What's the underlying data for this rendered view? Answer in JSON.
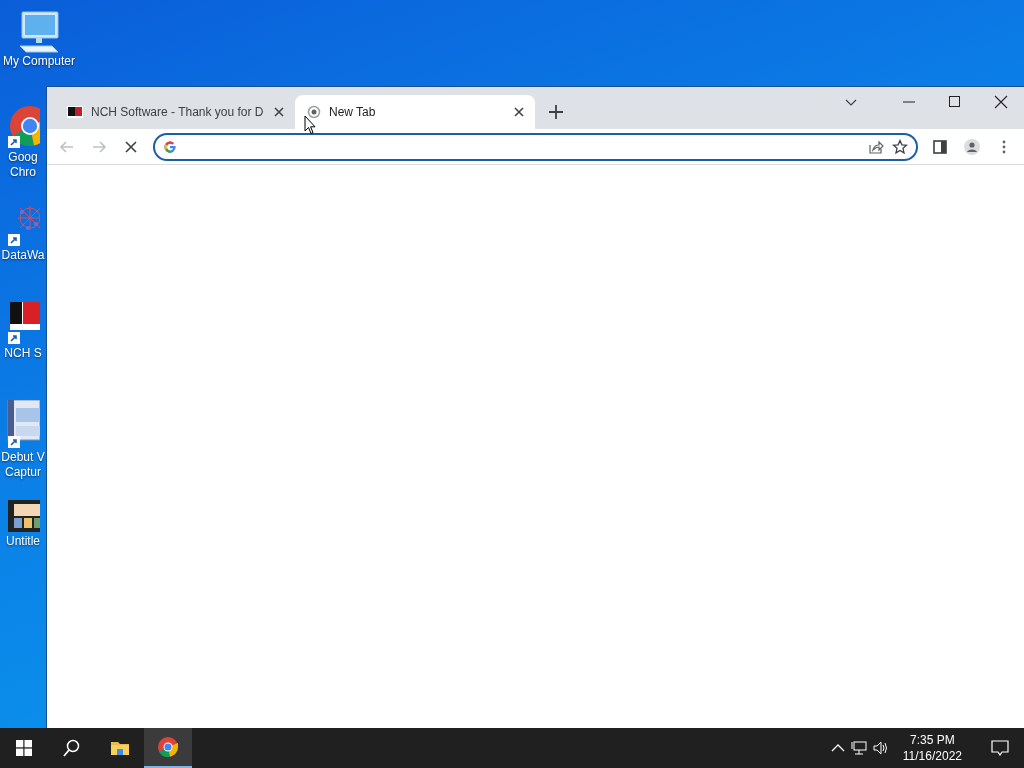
{
  "desktop": {
    "top_icon": {
      "kind": "computer",
      "lines": [
        "My Computer"
      ]
    },
    "side_icons": [
      {
        "kind": "chrome",
        "lines": [
          "Goog",
          "Chro"
        ]
      },
      {
        "kind": "network",
        "lines": [
          "DataWa"
        ]
      },
      {
        "kind": "nch",
        "lines": [
          "NCH S"
        ]
      },
      {
        "kind": "video",
        "lines": [
          "Debut V",
          "Captur"
        ]
      },
      {
        "kind": "thumbnail",
        "lines": [
          "Untitle"
        ]
      }
    ]
  },
  "browser": {
    "tabs": [
      {
        "kind": "nch",
        "title": "NCH Software - Thank you for D",
        "selected": false
      },
      {
        "kind": "loading",
        "title": "New Tab",
        "selected": true
      }
    ],
    "back_disabled": true,
    "forward_disabled": true,
    "loading": true
  },
  "taskbar": {
    "items": [
      {
        "kind": "search",
        "active": false
      },
      {
        "kind": "folder",
        "active": false
      },
      {
        "kind": "chrome",
        "active": true
      }
    ],
    "time": "7:35 PM",
    "date": "11/16/2022"
  }
}
